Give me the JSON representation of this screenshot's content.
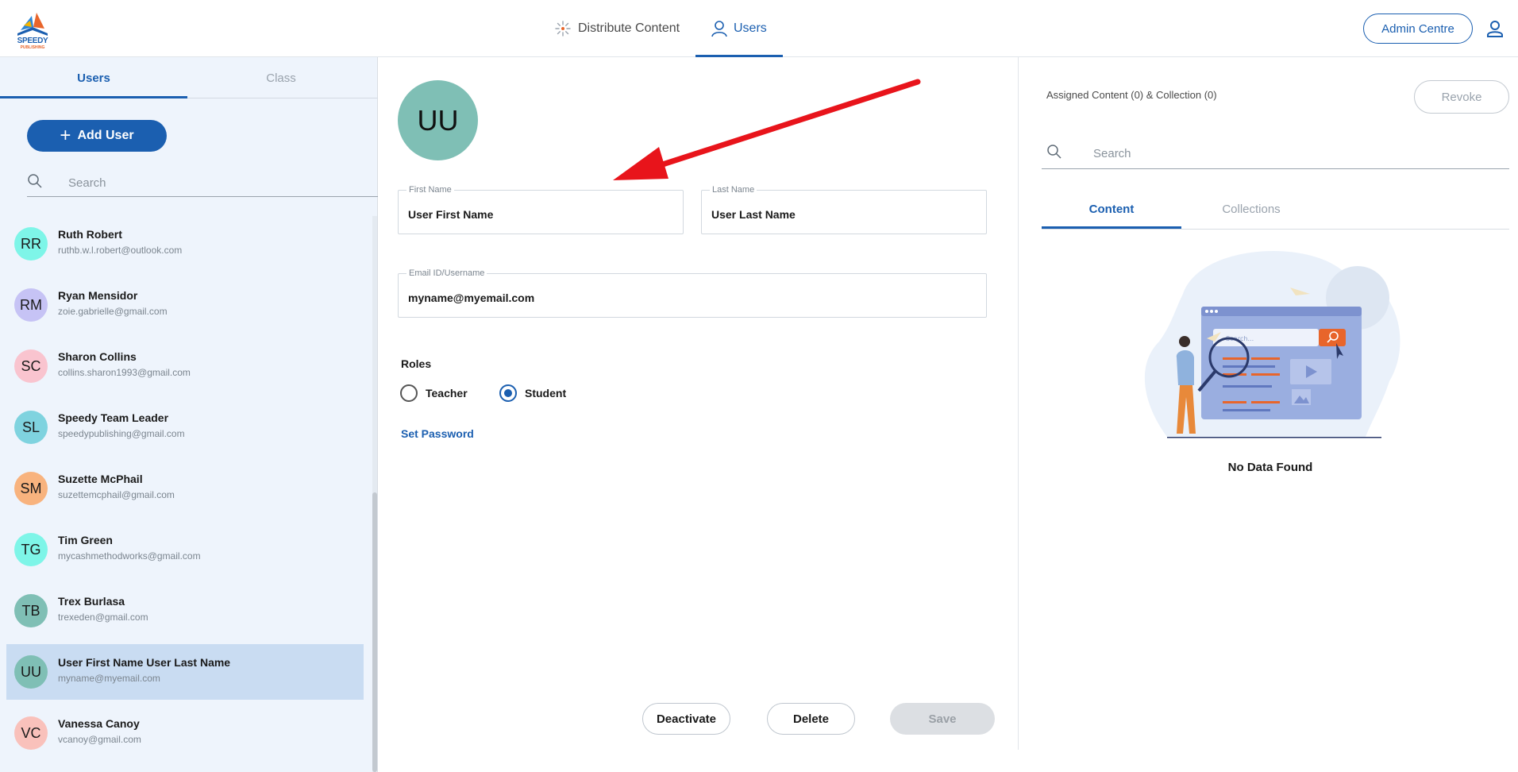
{
  "brand": {
    "logo_text": "SPEEDY",
    "logo_subtext": "PUBLISHING"
  },
  "topnav": {
    "tabs": [
      {
        "label": "Distribute Content",
        "icon": "sparkle-icon",
        "active": false
      },
      {
        "label": "Users",
        "icon": "user-outline-icon",
        "active": true
      }
    ],
    "admin_button": "Admin Centre",
    "profile_icon": "profile-icon"
  },
  "sidebar": {
    "tabs": [
      {
        "label": "Users",
        "active": true
      },
      {
        "label": "Class",
        "active": false
      }
    ],
    "add_button": "Add User",
    "search_placeholder": "Search",
    "users": [
      {
        "initials": "RR",
        "name": "Ruth Robert",
        "email": "ruthb.w.l.robert@outlook.com",
        "color": "#7ef5e8",
        "selected": false
      },
      {
        "initials": "RM",
        "name": "Ryan Mensidor",
        "email": "zoie.gabrielle@gmail.com",
        "color": "#c6c3f5",
        "selected": false
      },
      {
        "initials": "SC",
        "name": "Sharon Collins",
        "email": "collins.sharon1993@gmail.com",
        "color": "#f9c4cf",
        "selected": false
      },
      {
        "initials": "SL",
        "name": "Speedy Team Leader",
        "email": "speedypublishing@gmail.com",
        "color": "#7fd3df",
        "selected": false
      },
      {
        "initials": "SM",
        "name": "Suzette McPhail",
        "email": "suzettemcphail@gmail.com",
        "color": "#f8b37e",
        "selected": false
      },
      {
        "initials": "TG",
        "name": "Tim Green",
        "email": "mycashmethodworks@gmail.com",
        "color": "#7ef5e8",
        "selected": false
      },
      {
        "initials": "TB",
        "name": "Trex Burlasa",
        "email": "trexeden@gmail.com",
        "color": "#7fbfb5",
        "selected": false
      },
      {
        "initials": "UU",
        "name": "User First Name User Last Name",
        "email": "myname@myemail.com",
        "color": "#7fbfb5",
        "selected": true
      },
      {
        "initials": "VC",
        "name": "Vanessa Canoy",
        "email": "vcanoy@gmail.com",
        "color": "#f9c1bb",
        "selected": false
      }
    ]
  },
  "form": {
    "avatar_initials": "UU",
    "avatar_color": "#7fbfb5",
    "first_name": {
      "label": "First Name",
      "value": "User First Name"
    },
    "last_name": {
      "label": "Last Name",
      "value": "User Last Name"
    },
    "email": {
      "label": "Email ID/Username",
      "value": "myname@myemail.com"
    },
    "roles_label": "Roles",
    "roles": [
      {
        "label": "Teacher",
        "checked": false
      },
      {
        "label": "Student",
        "checked": true
      }
    ],
    "set_password": "Set Password",
    "buttons": {
      "deactivate": "Deactivate",
      "delete": "Delete",
      "save": "Save"
    }
  },
  "right_panel": {
    "assigned_text": "Assigned Content (0) & Collection (0)",
    "revoke_button": "Revoke",
    "search_placeholder": "Search",
    "tabs": [
      {
        "label": "Content",
        "active": true
      },
      {
        "label": "Collections",
        "active": false
      }
    ],
    "empty_illustration_text": "Search...",
    "empty_text": "No Data Found"
  },
  "colors": {
    "accent": "#1b5fb0",
    "annotation_arrow": "#e8141b",
    "sidebar_bg": "#eef4fc",
    "selected_row": "#c9dcf2"
  }
}
